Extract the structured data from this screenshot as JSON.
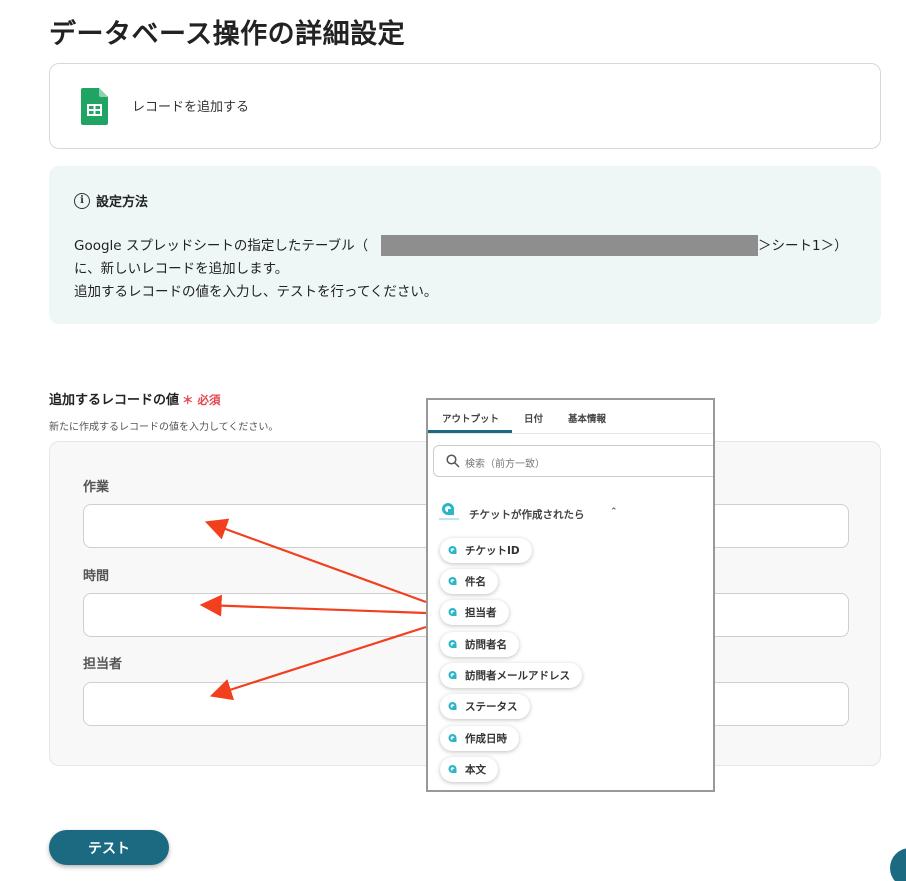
{
  "page": {
    "title": "データベース操作の詳細設定"
  },
  "action": {
    "label": "レコードを追加する",
    "icon": "google-sheets-icon"
  },
  "info": {
    "title": "設定方法",
    "line1_start": "Google スプレッドシートの指定したテーブル（",
    "line1_end": "＞シート1＞）",
    "line2": "に、新しいレコードを追加します。",
    "line3": "追加するレコードの値を入力し、テストを行ってください。"
  },
  "record_field": {
    "title": "追加するレコードの値",
    "required": "＊ 必須",
    "description": "新たに作成するレコードの値を入力してください。",
    "fields": [
      {
        "label": "作業",
        "value": ""
      },
      {
        "label": "時間",
        "value": ""
      },
      {
        "label": "担当者",
        "value": ""
      }
    ]
  },
  "popup": {
    "tabs": [
      "アウトプット",
      "日付",
      "基本情報"
    ],
    "active_tab": "アウトプット",
    "search_placeholder": "検索（前方一致）",
    "source": {
      "label": "チケットが作成されたら",
      "logo": "channel-talk-logo"
    },
    "chips": [
      "チケットID",
      "件名",
      "担当者",
      "訪問者名",
      "訪問者メールアドレス",
      "ステータス",
      "作成日時",
      "本文"
    ]
  },
  "buttons": {
    "test": "テスト"
  },
  "colors": {
    "accent": "#1b6a82",
    "required": "#e5484d",
    "arrow": "#f2401f",
    "info_bg": "#eef7f6"
  }
}
